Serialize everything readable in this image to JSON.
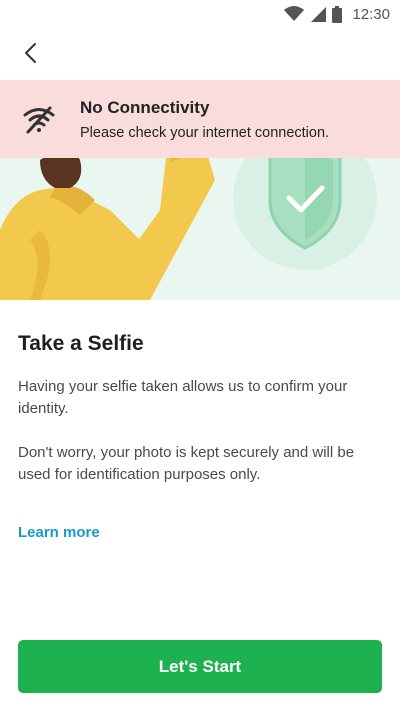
{
  "status_bar": {
    "time": "12:30",
    "icons": [
      "wifi-icon",
      "signal-icon",
      "battery-icon"
    ]
  },
  "app_bar": {
    "back_icon": "chevron-left-icon"
  },
  "banner": {
    "icon": "wifi-off-icon",
    "title": "No Connectivity",
    "message": "Please check your internet connection.",
    "background": "#f9dcdc"
  },
  "hero": {
    "illustration": "person-taking-selfie-with-shield-check",
    "background": "#eaf7f0"
  },
  "main": {
    "title": "Take a Selfie",
    "paragraph1": "Having your selfie taken allows us to confirm your identity.",
    "paragraph2": "Don't worry, your photo is kept securely and will be used for identification purposes only.",
    "learn_more": "Learn more",
    "link_color": "#1a9bc6"
  },
  "action": {
    "start_label": "Let's Start",
    "color": "#1db14f"
  }
}
